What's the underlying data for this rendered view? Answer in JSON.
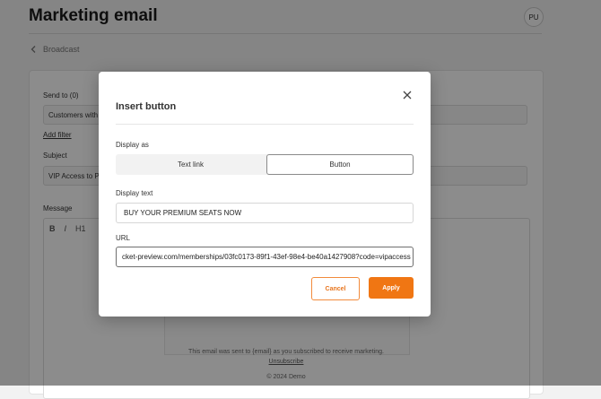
{
  "page": {
    "title": "Marketing email",
    "avatar_initials": "PU",
    "breadcrumb": "Broadcast"
  },
  "form": {
    "send_to_label": "Send to (0)",
    "send_to_value": "Customers with a",
    "add_filter": "Add filter",
    "subject_label": "Subject",
    "subject_value": "VIP Access to Pr",
    "message_label": "Message",
    "toolbar": {
      "bold": "B",
      "italic": "I",
      "heading": "H1"
    }
  },
  "footer": {
    "notice": "This email was sent to {email} as you subscribed to receive marketing.",
    "unsubscribe": "Unsubscribe",
    "copyright": "© 2024 Demo"
  },
  "modal": {
    "title": "Insert button",
    "display_as_label": "Display as",
    "options": [
      "Text link",
      "Button"
    ],
    "selected_option": "Button",
    "display_text_label": "Display text",
    "display_text_value": "BUY YOUR PREMIUM SEATS NOW",
    "url_label": "URL",
    "url_value": "cket-preview.com/memberships/03fc0173-89f1-43ef-98e4-be40a1427908?code=vipaccess",
    "cancel": "Cancel",
    "apply": "Apply"
  },
  "colors": {
    "accent": "#f07613",
    "overlay": "rgba(0,0,0,0.45)"
  }
}
